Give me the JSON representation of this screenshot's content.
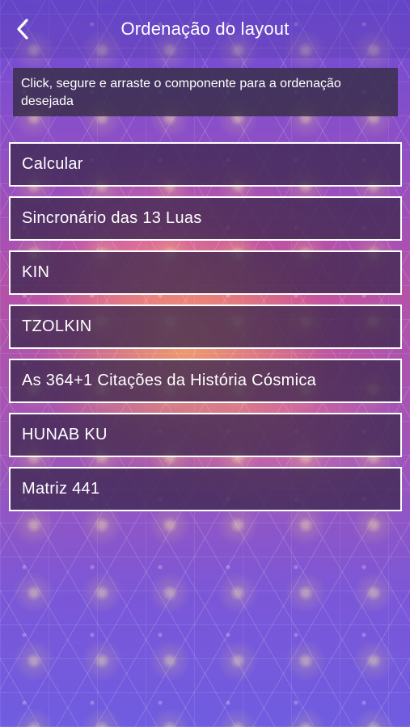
{
  "header": {
    "title": "Ordenação do layout",
    "back_icon": "chevron-left-icon"
  },
  "instruction": "Click, segure e arraste o componente para a ordenação desejada",
  "components": [
    {
      "label": "Calcular"
    },
    {
      "label": "Sincronário das 13 Luas"
    },
    {
      "label": "KIN"
    },
    {
      "label": "TZOLKIN"
    },
    {
      "label": "As 364+1 Citações da História Cósmica"
    },
    {
      "label": "HUNAB KU"
    },
    {
      "label": "Matriz 441"
    }
  ],
  "colors": {
    "text": "#ffffff",
    "item_border": "#ffffff",
    "item_background": "#3c2850"
  }
}
